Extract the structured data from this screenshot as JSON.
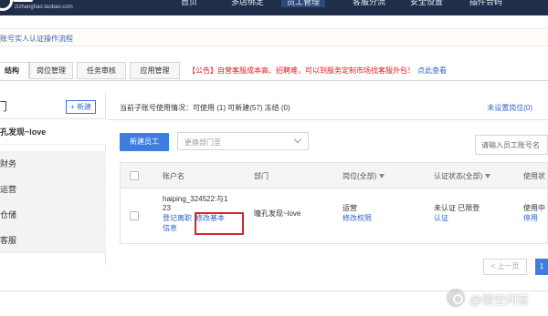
{
  "topbar": {
    "domain": "zizhanghao.taobao.com",
    "nav": [
      "首页",
      "多店绑定",
      "员工管理",
      "客服分流",
      "安全设置",
      "插件合码"
    ]
  },
  "notice": {
    "text": "账号实人认证操作流程"
  },
  "tabs": {
    "items": [
      "结构",
      "岗位管理",
      "任务审核",
      "应用管理"
    ],
    "announcement_main": "【公告】自营客服成本高、招聘难，可以到服务定制市场找客服外包！",
    "announcement_link": "点此查看"
  },
  "sidebar": {
    "title": "门",
    "new_button": "+ 新建",
    "root": "孔发现~love",
    "children": [
      "财务",
      "运营",
      "仓储",
      "客服"
    ]
  },
  "main": {
    "usage_text": "当前子账号使用情况：可使用 (1)   可新建(57)   冻结 (0)",
    "unset_link": "未设置岗位(0)",
    "new_employee_button": "新建员工",
    "change_dept_placeholder": "更换部门至",
    "search_placeholder": "请输入员工账号名"
  },
  "table": {
    "headers": {
      "account": "账户名",
      "dept": "部门",
      "position": "岗位(全部)",
      "auth": "认证状态(全部)",
      "usage": "使用状"
    },
    "row": {
      "account_line1": "haiping_324522:与1",
      "account_line2": "23",
      "action_login": "登记离职",
      "action_edit": "修改基本",
      "action_info": "信息",
      "dept": "瞳孔发现~love",
      "position": "运营",
      "position_link": "修改权限",
      "auth_status": "未认证 已限登",
      "auth_link": "认证",
      "usage_status": "使用中",
      "usage_link": "停用"
    }
  },
  "pagination": {
    "prev": "< 上一页",
    "current": "1"
  },
  "watermark": {
    "text": "@悟空问答"
  }
}
